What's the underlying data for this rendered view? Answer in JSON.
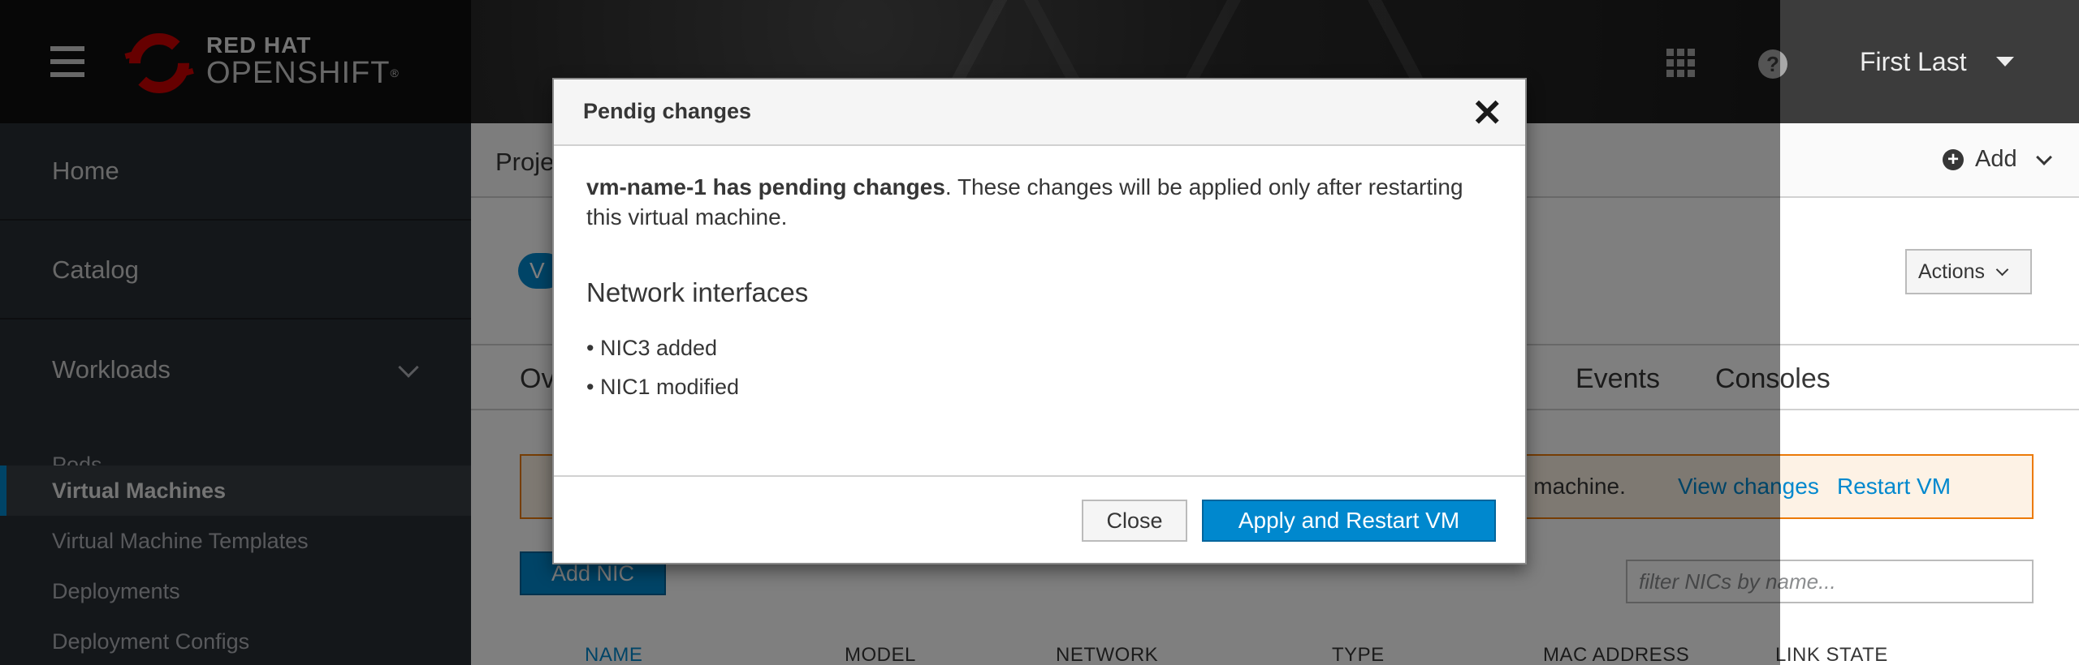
{
  "masthead": {
    "brand_line1": "RED HAT",
    "brand_line2": "OPENSHIFT",
    "brand_mark": "®",
    "user_name": "First Last",
    "icons": [
      "hamburger-icon",
      "grid-icon",
      "help-icon",
      "caret-down-icon"
    ]
  },
  "sidebar": {
    "items": [
      {
        "label": "Home"
      },
      {
        "label": "Catalog"
      },
      {
        "label": "Workloads"
      }
    ],
    "sub_items": [
      {
        "label": "Pods"
      },
      {
        "label": "Virtual Machines",
        "active": true
      },
      {
        "label": "Virtual Machine Templates"
      },
      {
        "label": "Deployments"
      },
      {
        "label": "Deployment Configs"
      }
    ]
  },
  "main": {
    "project_label": "Proje",
    "add_label": "Add",
    "badge_label": "V",
    "actions_label": "Actions",
    "tabs": [
      "Ov",
      "Events",
      "Consoles"
    ],
    "alert_text": "rtual machine.",
    "alert_link_view": "View changes",
    "alert_link_restart": "Restart VM",
    "add_nic_label": "Add NIC",
    "filter_placeholder": "filter NICs by name...",
    "columns": [
      "NAME",
      "MODEL",
      "NETWORK",
      "TYPE",
      "MAC ADDRESS",
      "LINK STATE"
    ]
  },
  "modal": {
    "title": "Pendig changes",
    "close_glyph": "✕",
    "message_bold": "vm-name-1 has pending changes",
    "message_rest": ". These changes will be applied only after restarting this virtual machine.",
    "section_title": "Network interfaces",
    "changes": [
      "• NIC3 added",
      "• NIC1 modified"
    ],
    "close_button": "Close",
    "apply_button": "Apply and Restart VM"
  },
  "colors": {
    "accent": "#0088ce",
    "warning": "#ec7a08",
    "brand_red": "#cc0000"
  }
}
